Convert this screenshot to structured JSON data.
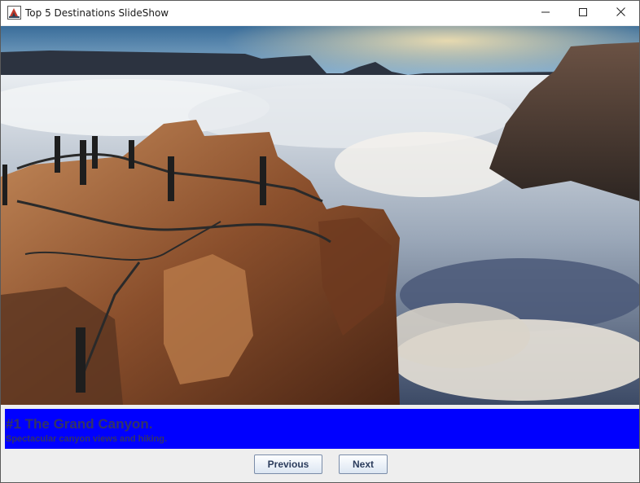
{
  "window": {
    "title": "Top 5 Destinations SlideShow",
    "icons": {
      "app": "java-app-icon",
      "minimize": "minimize-icon",
      "maximize": "maximize-icon",
      "close": "close-icon"
    }
  },
  "slide": {
    "image": "grand-canyon-photo",
    "title": "#1 The Grand Canyon.",
    "description": "Spectacular canyon views and hiking."
  },
  "colors": {
    "caption_background": "#0000ff",
    "caption_text": "#333366"
  },
  "buttons": {
    "previous_label": "Previous",
    "next_label": "Next"
  }
}
